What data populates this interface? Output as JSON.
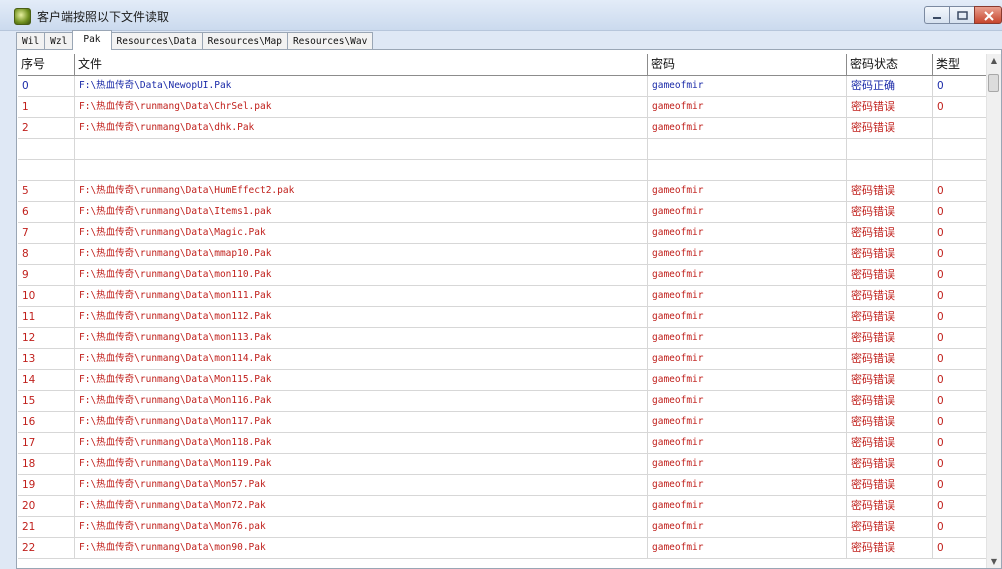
{
  "window": {
    "title": "客户端按照以下文件读取"
  },
  "tabs": [
    {
      "label": "Wil"
    },
    {
      "label": "Wzl"
    },
    {
      "label": "Pak",
      "active": true
    },
    {
      "label": "Resources\\Data"
    },
    {
      "label": "Resources\\Map"
    },
    {
      "label": "Resources\\Wav"
    }
  ],
  "table": {
    "headers": [
      "序号",
      "文件",
      "密码",
      "密码状态",
      "类型"
    ],
    "rows": [
      {
        "idx": "0",
        "file": "F:\\热血传奇\\Data\\NewopUI.Pak",
        "pwd": "gameofmir",
        "status": "密码正确",
        "type": "0",
        "color": "blue"
      },
      {
        "idx": "1",
        "file": "F:\\热血传奇\\runmang\\Data\\ChrSel.pak",
        "pwd": "gameofmir",
        "status": "密码错误",
        "type": "0",
        "color": "red"
      },
      {
        "idx": "2",
        "file": "F:\\热血传奇\\runmang\\Data\\dhk.Pak",
        "pwd": "gameofmir",
        "status": "密码错误",
        "type": "",
        "color": "red"
      },
      {
        "idx": "",
        "file": "",
        "pwd": "",
        "status": "",
        "type": "",
        "color": "red"
      },
      {
        "idx": "",
        "file": "",
        "pwd": "",
        "status": "",
        "type": "",
        "color": "red"
      },
      {
        "idx": "5",
        "file": "F:\\热血传奇\\runmang\\Data\\HumEffect2.pak",
        "pwd": "gameofmir",
        "status": "密码错误",
        "type": "0",
        "color": "red"
      },
      {
        "idx": "6",
        "file": "F:\\热血传奇\\runmang\\Data\\Items1.pak",
        "pwd": "gameofmir",
        "status": "密码错误",
        "type": "0",
        "color": "red"
      },
      {
        "idx": "7",
        "file": "F:\\热血传奇\\runmang\\Data\\Magic.Pak",
        "pwd": "gameofmir",
        "status": "密码错误",
        "type": "0",
        "color": "red"
      },
      {
        "idx": "8",
        "file": "F:\\热血传奇\\runmang\\Data\\mmap10.Pak",
        "pwd": "gameofmir",
        "status": "密码错误",
        "type": "0",
        "color": "red"
      },
      {
        "idx": "9",
        "file": "F:\\热血传奇\\runmang\\Data\\mon110.Pak",
        "pwd": "gameofmir",
        "status": "密码错误",
        "type": "0",
        "color": "red"
      },
      {
        "idx": "10",
        "file": "F:\\热血传奇\\runmang\\Data\\mon111.Pak",
        "pwd": "gameofmir",
        "status": "密码错误",
        "type": "0",
        "color": "red"
      },
      {
        "idx": "11",
        "file": "F:\\热血传奇\\runmang\\Data\\mon112.Pak",
        "pwd": "gameofmir",
        "status": "密码错误",
        "type": "0",
        "color": "red"
      },
      {
        "idx": "12",
        "file": "F:\\热血传奇\\runmang\\Data\\mon113.Pak",
        "pwd": "gameofmir",
        "status": "密码错误",
        "type": "0",
        "color": "red"
      },
      {
        "idx": "13",
        "file": "F:\\热血传奇\\runmang\\Data\\mon114.Pak",
        "pwd": "gameofmir",
        "status": "密码错误",
        "type": "0",
        "color": "red"
      },
      {
        "idx": "14",
        "file": "F:\\热血传奇\\runmang\\Data\\Mon115.Pak",
        "pwd": "gameofmir",
        "status": "密码错误",
        "type": "0",
        "color": "red"
      },
      {
        "idx": "15",
        "file": "F:\\热血传奇\\runmang\\Data\\Mon116.Pak",
        "pwd": "gameofmir",
        "status": "密码错误",
        "type": "0",
        "color": "red"
      },
      {
        "idx": "16",
        "file": "F:\\热血传奇\\runmang\\Data\\Mon117.Pak",
        "pwd": "gameofmir",
        "status": "密码错误",
        "type": "0",
        "color": "red"
      },
      {
        "idx": "17",
        "file": "F:\\热血传奇\\runmang\\Data\\Mon118.Pak",
        "pwd": "gameofmir",
        "status": "密码错误",
        "type": "0",
        "color": "red"
      },
      {
        "idx": "18",
        "file": "F:\\热血传奇\\runmang\\Data\\Mon119.Pak",
        "pwd": "gameofmir",
        "status": "密码错误",
        "type": "0",
        "color": "red"
      },
      {
        "idx": "19",
        "file": "F:\\热血传奇\\runmang\\Data\\Mon57.Pak",
        "pwd": "gameofmir",
        "status": "密码错误",
        "type": "0",
        "color": "red"
      },
      {
        "idx": "20",
        "file": "F:\\热血传奇\\runmang\\Data\\Mon72.Pak",
        "pwd": "gameofmir",
        "status": "密码错误",
        "type": "0",
        "color": "red"
      },
      {
        "idx": "21",
        "file": "F:\\热血传奇\\runmang\\Data\\Mon76.pak",
        "pwd": "gameofmir",
        "status": "密码错误",
        "type": "0",
        "color": "red"
      },
      {
        "idx": "22",
        "file": "F:\\热血传奇\\runmang\\Data\\mon90.Pak",
        "pwd": "gameofmir",
        "status": "密码错误",
        "type": "0",
        "color": "red"
      }
    ]
  },
  "colors": {
    "ok": "#1a2aa8",
    "error": "#c0201c"
  },
  "icons": {
    "app": "app-icon",
    "minimize": "minimize-icon",
    "maximize": "maximize-icon",
    "close": "close-icon"
  }
}
